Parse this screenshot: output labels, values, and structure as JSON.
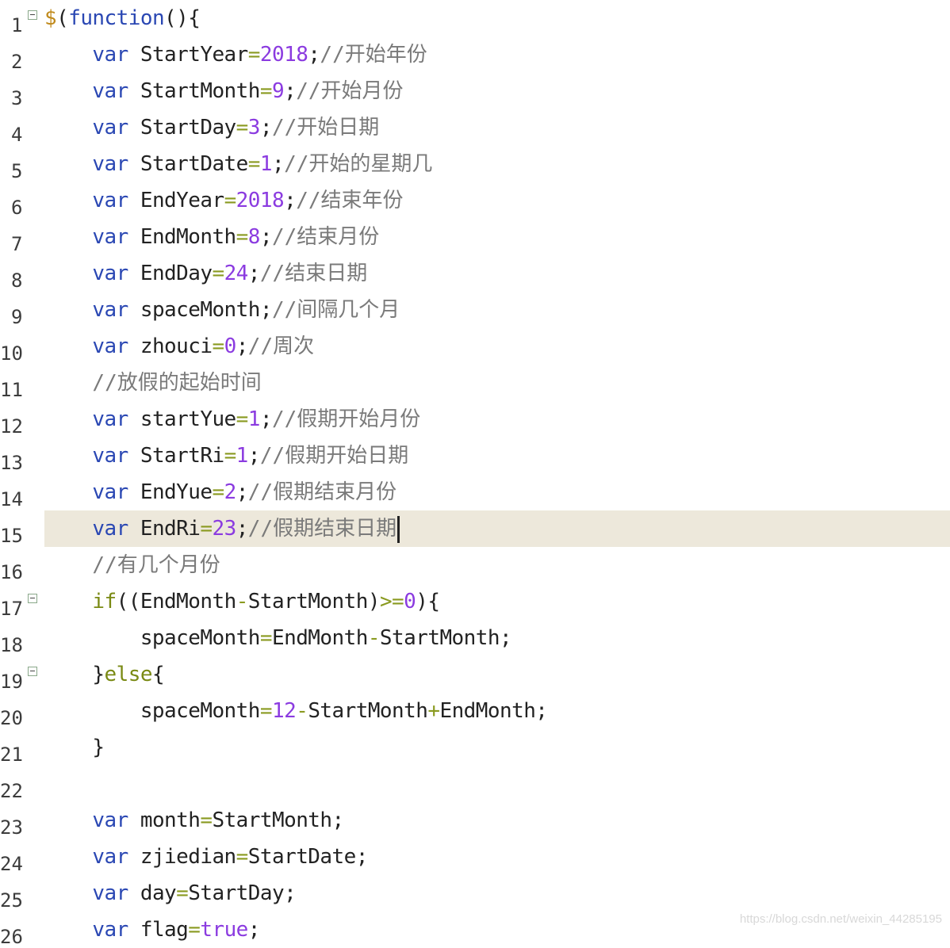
{
  "editor": {
    "lines": [
      {
        "n": "1",
        "fold": true,
        "tokens": [
          [
            "dollar",
            "$"
          ],
          [
            "p",
            "("
          ],
          [
            "fn",
            "function"
          ],
          [
            "p",
            "(){"
          ]
        ]
      },
      {
        "n": "2",
        "fold": false,
        "tokens": [
          [
            "i",
            "    "
          ],
          [
            "kw",
            "var"
          ],
          [
            "p",
            " StartYear"
          ],
          [
            "op",
            "="
          ],
          [
            "num",
            "2018"
          ],
          [
            "p",
            ";"
          ],
          [
            "cm",
            "//开始年份"
          ]
        ]
      },
      {
        "n": "3",
        "fold": false,
        "tokens": [
          [
            "i",
            "    "
          ],
          [
            "kw",
            "var"
          ],
          [
            "p",
            " StartMonth"
          ],
          [
            "op",
            "="
          ],
          [
            "num",
            "9"
          ],
          [
            "p",
            ";"
          ],
          [
            "cm",
            "//开始月份"
          ]
        ]
      },
      {
        "n": "4",
        "fold": false,
        "tokens": [
          [
            "i",
            "    "
          ],
          [
            "kw",
            "var"
          ],
          [
            "p",
            " StartDay"
          ],
          [
            "op",
            "="
          ],
          [
            "num",
            "3"
          ],
          [
            "p",
            ";"
          ],
          [
            "cm",
            "//开始日期"
          ]
        ]
      },
      {
        "n": "5",
        "fold": false,
        "tokens": [
          [
            "i",
            "    "
          ],
          [
            "kw",
            "var"
          ],
          [
            "p",
            " StartDate"
          ],
          [
            "op",
            "="
          ],
          [
            "num",
            "1"
          ],
          [
            "p",
            ";"
          ],
          [
            "cm",
            "//开始的星期几"
          ]
        ]
      },
      {
        "n": "6",
        "fold": false,
        "tokens": [
          [
            "i",
            "    "
          ],
          [
            "kw",
            "var"
          ],
          [
            "p",
            " EndYear"
          ],
          [
            "op",
            "="
          ],
          [
            "num",
            "2018"
          ],
          [
            "p",
            ";"
          ],
          [
            "cm",
            "//结束年份"
          ]
        ]
      },
      {
        "n": "7",
        "fold": false,
        "tokens": [
          [
            "i",
            "    "
          ],
          [
            "kw",
            "var"
          ],
          [
            "p",
            " EndMonth"
          ],
          [
            "op",
            "="
          ],
          [
            "num",
            "8"
          ],
          [
            "p",
            ";"
          ],
          [
            "cm",
            "//结束月份"
          ]
        ]
      },
      {
        "n": "8",
        "fold": false,
        "tokens": [
          [
            "i",
            "    "
          ],
          [
            "kw",
            "var"
          ],
          [
            "p",
            " EndDay"
          ],
          [
            "op",
            "="
          ],
          [
            "num",
            "24"
          ],
          [
            "p",
            ";"
          ],
          [
            "cm",
            "//结束日期"
          ]
        ]
      },
      {
        "n": "9",
        "fold": false,
        "tokens": [
          [
            "i",
            "    "
          ],
          [
            "kw",
            "var"
          ],
          [
            "p",
            " spaceMonth;"
          ],
          [
            "cm",
            "//间隔几个月"
          ]
        ]
      },
      {
        "n": "10",
        "fold": false,
        "tokens": [
          [
            "i",
            "    "
          ],
          [
            "kw",
            "var"
          ],
          [
            "p",
            " zhouci"
          ],
          [
            "op",
            "="
          ],
          [
            "num",
            "0"
          ],
          [
            "p",
            ";"
          ],
          [
            "cm",
            "//周次"
          ]
        ]
      },
      {
        "n": "11",
        "fold": false,
        "tokens": [
          [
            "i",
            "    "
          ],
          [
            "cm",
            "//放假的起始时间"
          ]
        ]
      },
      {
        "n": "12",
        "fold": false,
        "tokens": [
          [
            "i",
            "    "
          ],
          [
            "kw",
            "var"
          ],
          [
            "p",
            " startYue"
          ],
          [
            "op",
            "="
          ],
          [
            "num",
            "1"
          ],
          [
            "p",
            ";"
          ],
          [
            "cm",
            "//假期开始月份"
          ]
        ]
      },
      {
        "n": "13",
        "fold": false,
        "tokens": [
          [
            "i",
            "    "
          ],
          [
            "kw",
            "var"
          ],
          [
            "p",
            " StartRi"
          ],
          [
            "op",
            "="
          ],
          [
            "num",
            "1"
          ],
          [
            "p",
            ";"
          ],
          [
            "cm",
            "//假期开始日期"
          ]
        ]
      },
      {
        "n": "14",
        "fold": false,
        "tokens": [
          [
            "i",
            "    "
          ],
          [
            "kw",
            "var"
          ],
          [
            "p",
            " EndYue"
          ],
          [
            "op",
            "="
          ],
          [
            "num",
            "2"
          ],
          [
            "p",
            ";"
          ],
          [
            "cm",
            "//假期结束月份"
          ]
        ]
      },
      {
        "n": "15",
        "fold": false,
        "current": true,
        "tokens": [
          [
            "i",
            "    "
          ],
          [
            "kw",
            "var"
          ],
          [
            "p",
            " EndRi"
          ],
          [
            "op",
            "="
          ],
          [
            "num",
            "23"
          ],
          [
            "p",
            ";"
          ],
          [
            "cm",
            "//假期结束日期"
          ]
        ]
      },
      {
        "n": "16",
        "fold": false,
        "tokens": [
          [
            "i",
            "    "
          ],
          [
            "cm",
            "//有几个月份"
          ]
        ]
      },
      {
        "n": "17",
        "fold": true,
        "tokens": [
          [
            "i",
            "    "
          ],
          [
            "kw2",
            "if"
          ],
          [
            "p",
            "((EndMonth"
          ],
          [
            "op",
            "-"
          ],
          [
            "p",
            "StartMonth)"
          ],
          [
            "op",
            ">="
          ],
          [
            "num",
            "0"
          ],
          [
            "p",
            "){"
          ]
        ]
      },
      {
        "n": "18",
        "fold": false,
        "tokens": [
          [
            "i",
            "        "
          ],
          [
            "p",
            "spaceMonth"
          ],
          [
            "op",
            "="
          ],
          [
            "p",
            "EndMonth"
          ],
          [
            "op",
            "-"
          ],
          [
            "p",
            "StartMonth;"
          ]
        ]
      },
      {
        "n": "19",
        "fold": true,
        "tokens": [
          [
            "i",
            "    "
          ],
          [
            "p",
            "}"
          ],
          [
            "kw2",
            "else"
          ],
          [
            "p",
            "{"
          ]
        ]
      },
      {
        "n": "20",
        "fold": false,
        "tokens": [
          [
            "i",
            "        "
          ],
          [
            "p",
            "spaceMonth"
          ],
          [
            "op",
            "="
          ],
          [
            "num",
            "12"
          ],
          [
            "op",
            "-"
          ],
          [
            "p",
            "StartMonth"
          ],
          [
            "op",
            "+"
          ],
          [
            "p",
            "EndMonth;"
          ]
        ]
      },
      {
        "n": "21",
        "fold": false,
        "tokens": [
          [
            "i",
            "    "
          ],
          [
            "p",
            "}"
          ]
        ]
      },
      {
        "n": "22",
        "fold": false,
        "tokens": []
      },
      {
        "n": "23",
        "fold": false,
        "tokens": [
          [
            "i",
            "    "
          ],
          [
            "kw",
            "var"
          ],
          [
            "p",
            " month"
          ],
          [
            "op",
            "="
          ],
          [
            "p",
            "StartMonth;"
          ]
        ]
      },
      {
        "n": "24",
        "fold": false,
        "tokens": [
          [
            "i",
            "    "
          ],
          [
            "kw",
            "var"
          ],
          [
            "p",
            " zjiedian"
          ],
          [
            "op",
            "="
          ],
          [
            "p",
            "StartDate;"
          ]
        ]
      },
      {
        "n": "25",
        "fold": false,
        "tokens": [
          [
            "i",
            "    "
          ],
          [
            "kw",
            "var"
          ],
          [
            "p",
            " day"
          ],
          [
            "op",
            "="
          ],
          [
            "p",
            "StartDay;"
          ]
        ]
      },
      {
        "n": "26",
        "fold": false,
        "tokens": [
          [
            "i",
            "    "
          ],
          [
            "kw",
            "var"
          ],
          [
            "p",
            " flag"
          ],
          [
            "op",
            "="
          ],
          [
            "num",
            "true"
          ],
          [
            "p",
            ";"
          ]
        ]
      }
    ]
  },
  "watermark": "https://blog.csdn.net/weixin_44285195",
  "colors": {
    "keyword": "#2a47b3",
    "control_keyword": "#7a8a14",
    "number": "#8b3be0",
    "operator": "#8a9a20",
    "comment": "#7a7a7a",
    "current_line": "#ede8db"
  }
}
